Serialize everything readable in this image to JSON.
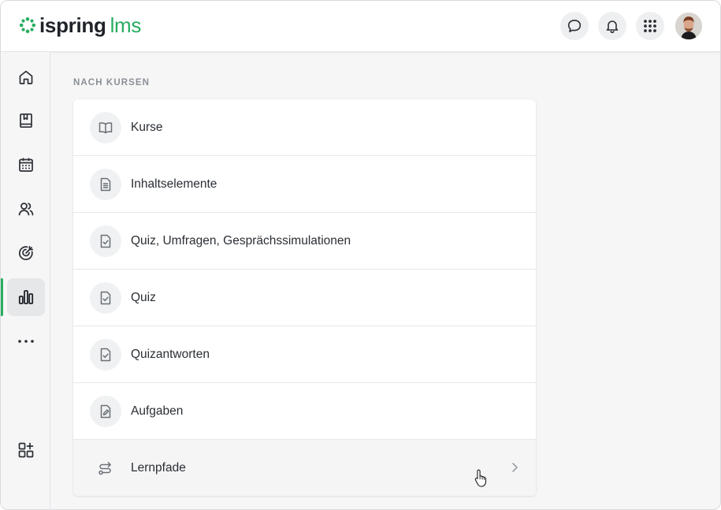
{
  "header": {
    "logo_main": "ispring",
    "logo_sub": "lms",
    "brand_color": "#27ae60",
    "icons": [
      "chat-icon",
      "bell-icon",
      "apps-grid-icon",
      "user-avatar"
    ]
  },
  "sidebar": {
    "items": [
      {
        "name": "home-icon"
      },
      {
        "name": "book-icon"
      },
      {
        "name": "calendar-icon"
      },
      {
        "name": "users-icon"
      },
      {
        "name": "target-icon"
      },
      {
        "name": "reports-icon",
        "active": true
      },
      {
        "name": "more-icon"
      },
      {
        "name": "add-widget-icon"
      }
    ]
  },
  "main": {
    "section_title": "NACH KURSEN",
    "rows": [
      {
        "label": "Kurse",
        "icon": "book-open-icon"
      },
      {
        "label": "Inhaltselemente",
        "icon": "document-icon"
      },
      {
        "label": "Quiz, Umfragen, Gesprächssimulationen",
        "icon": "checklist-icon"
      },
      {
        "label": "Quiz",
        "icon": "checklist-icon"
      },
      {
        "label": "Quizantworten",
        "icon": "checklist-icon"
      },
      {
        "label": "Aufgaben",
        "icon": "edit-document-icon"
      },
      {
        "label": "Lernpfade",
        "icon": "path-icon",
        "hovered": true
      }
    ]
  }
}
